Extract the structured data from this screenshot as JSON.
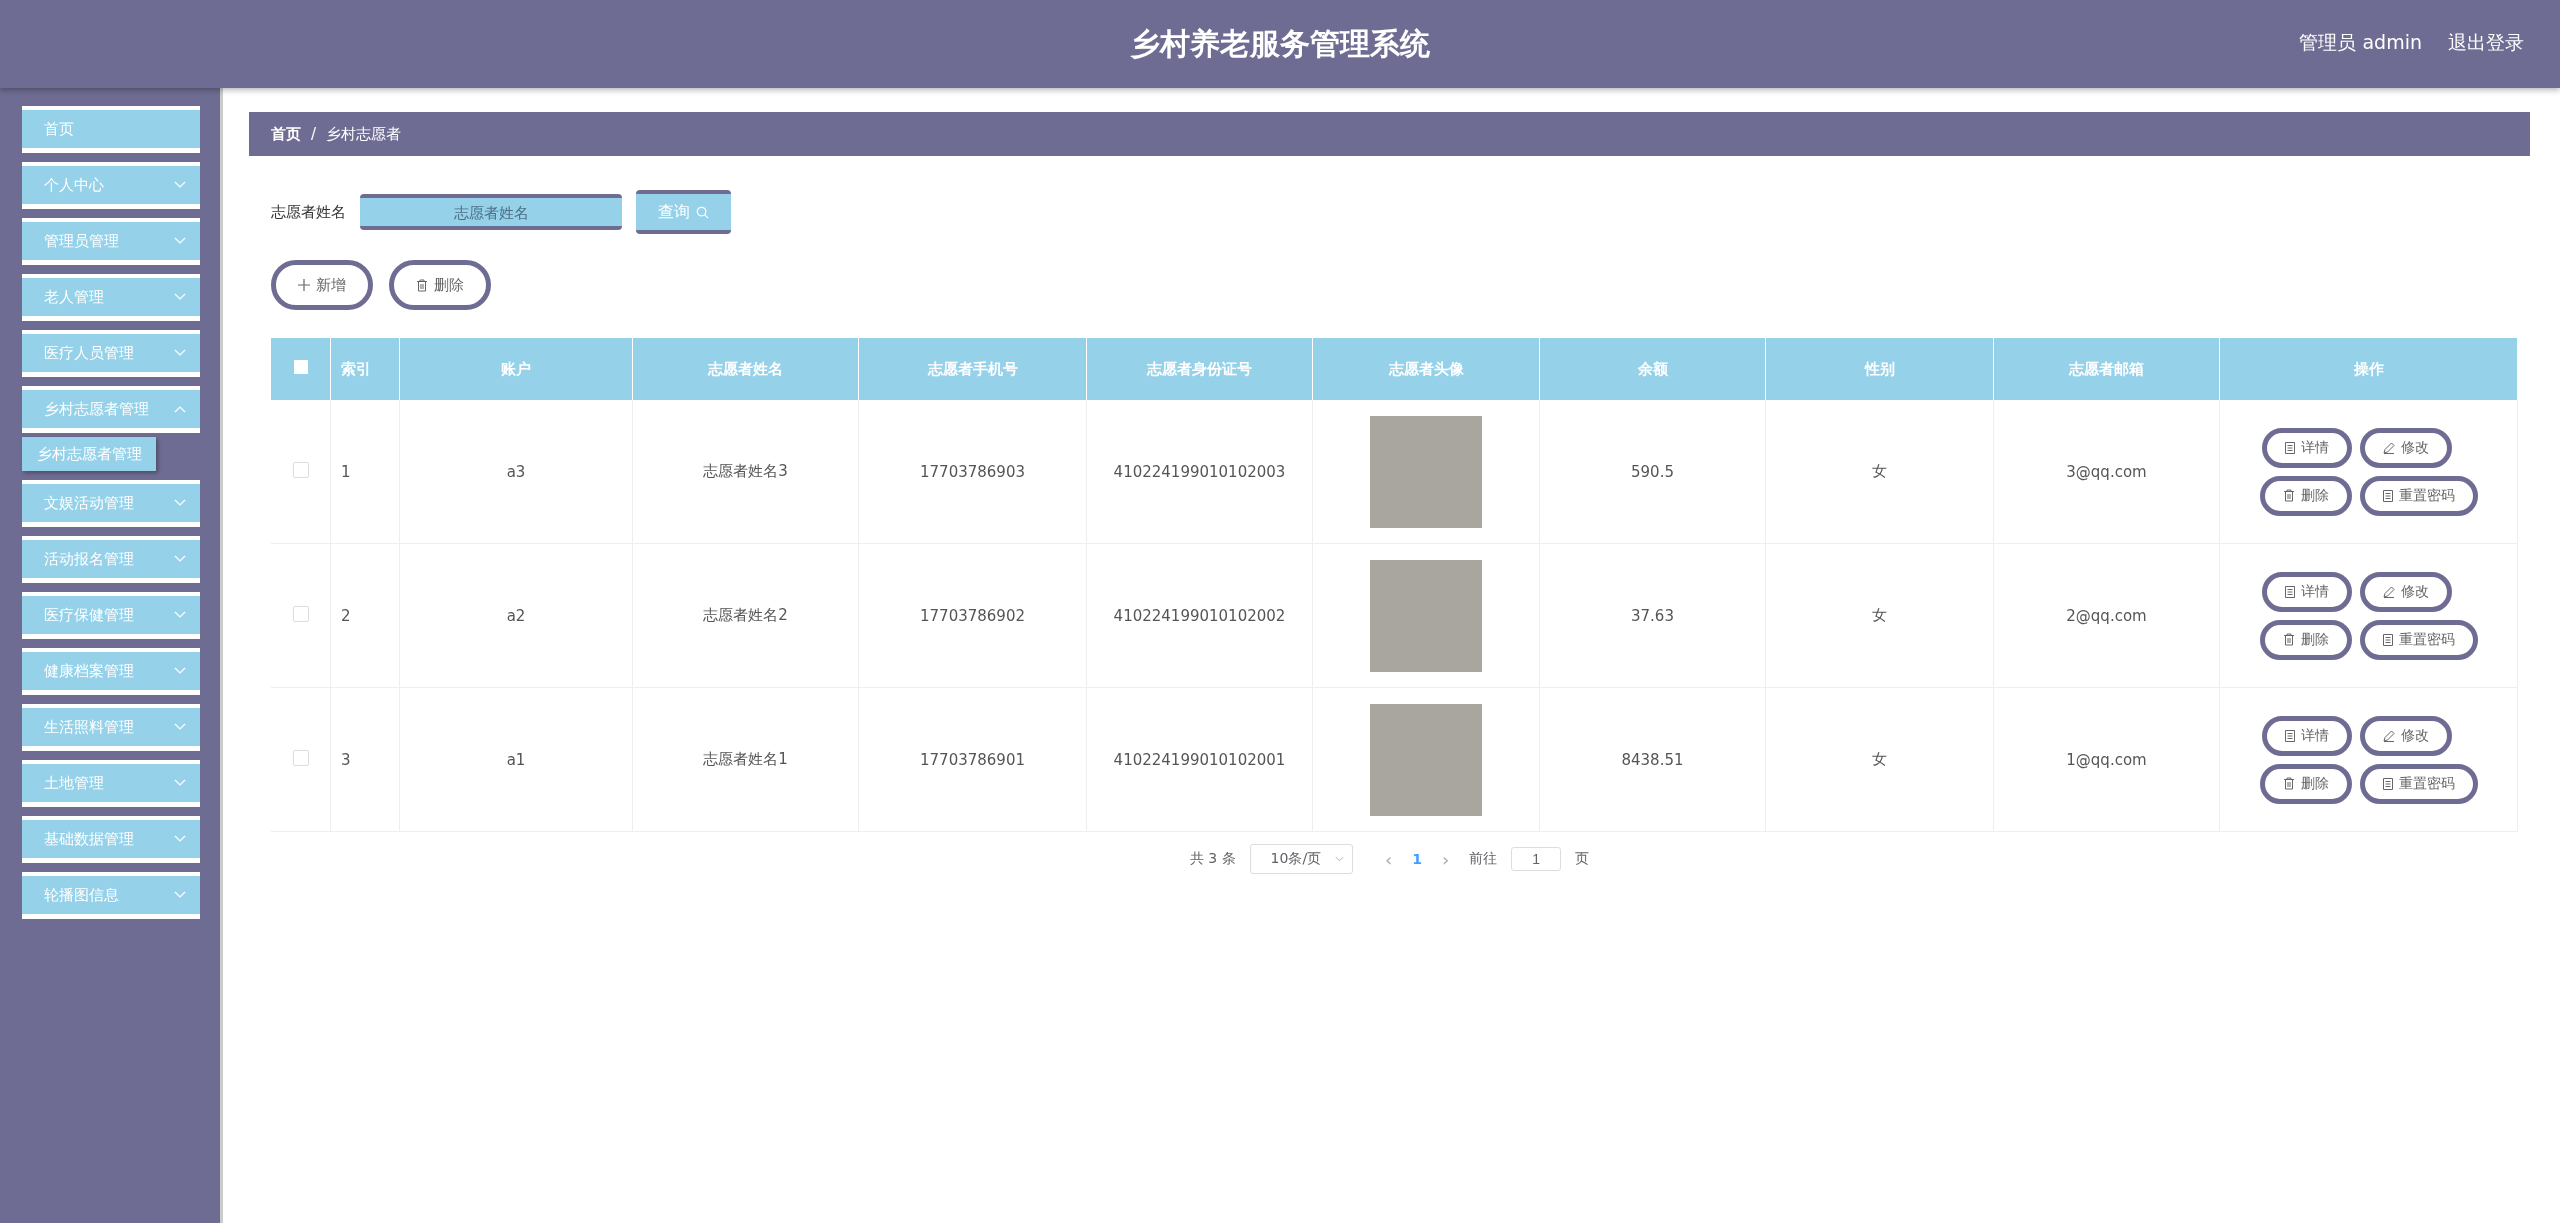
{
  "header": {
    "title": "乡村养老服务管理系统",
    "user": "管理员 admin",
    "logout": "退出登录"
  },
  "sidebar": {
    "items": [
      {
        "label": "首页",
        "kind": "link"
      },
      {
        "label": "个人中心",
        "kind": "submenu",
        "expanded": false
      },
      {
        "label": "管理员管理",
        "kind": "submenu",
        "expanded": false
      },
      {
        "label": "老人管理",
        "kind": "submenu",
        "expanded": false
      },
      {
        "label": "医疗人员管理",
        "kind": "submenu",
        "expanded": false
      },
      {
        "label": "乡村志愿者管理",
        "kind": "submenu",
        "expanded": true,
        "children": [
          {
            "label": "乡村志愿者管理"
          }
        ]
      },
      {
        "label": "文娱活动管理",
        "kind": "submenu",
        "expanded": false
      },
      {
        "label": "活动报名管理",
        "kind": "submenu",
        "expanded": false
      },
      {
        "label": "医疗保健管理",
        "kind": "submenu",
        "expanded": false
      },
      {
        "label": "健康档案管理",
        "kind": "submenu",
        "expanded": false
      },
      {
        "label": "生活照料管理",
        "kind": "submenu",
        "expanded": false
      },
      {
        "label": "土地管理",
        "kind": "submenu",
        "expanded": false
      },
      {
        "label": "基础数据管理",
        "kind": "submenu",
        "expanded": false
      },
      {
        "label": "轮播图信息",
        "kind": "submenu",
        "expanded": false
      }
    ]
  },
  "breadcrumb": [
    "首页",
    "/",
    "乡村志愿者"
  ],
  "search": {
    "label": "志愿者姓名",
    "placeholder": "志愿者姓名",
    "button": "查询"
  },
  "actions": [
    {
      "label": "新增",
      "kind": "add"
    },
    {
      "label": "删除",
      "kind": "delete"
    }
  ],
  "table": {
    "select_all": {
      "checked": false
    },
    "columns": [
      "索引",
      "账户",
      "志愿者姓名",
      "志愿者手机号",
      "志愿者身份证号",
      "志愿者头像",
      "余额",
      "性别",
      "志愿者邮箱",
      "操作"
    ],
    "rows": [
      {
        "checked": false,
        "cells": [
          "1",
          "a3",
          "志愿者姓名3",
          "17703786903",
          "410224199010102003",
          "",
          "590.5",
          "女",
          "3@qq.com"
        ],
        "buttons": [
          {
            "label": "详情",
            "kind": "detail"
          },
          {
            "label": "修改",
            "kind": "edit"
          },
          {
            "label": "删除",
            "kind": "delete"
          },
          {
            "label": "重置密码",
            "kind": "detail"
          }
        ]
      },
      {
        "checked": false,
        "cells": [
          "2",
          "a2",
          "志愿者姓名2",
          "17703786902",
          "410224199010102002",
          "",
          "37.63",
          "女",
          "2@qq.com"
        ],
        "buttons": [
          {
            "label": "详情",
            "kind": "detail"
          },
          {
            "label": "修改",
            "kind": "edit"
          },
          {
            "label": "删除",
            "kind": "delete"
          },
          {
            "label": "重置密码",
            "kind": "detail"
          }
        ]
      },
      {
        "checked": false,
        "cells": [
          "3",
          "a1",
          "志愿者姓名1",
          "17703786901",
          "410224199010102001",
          "",
          "8438.51",
          "女",
          "1@qq.com"
        ],
        "buttons": [
          {
            "label": "详情",
            "kind": "detail"
          },
          {
            "label": "修改",
            "kind": "edit"
          },
          {
            "label": "删除",
            "kind": "delete"
          },
          {
            "label": "重置密码",
            "kind": "detail"
          }
        ]
      }
    ]
  },
  "pagination": {
    "total": "共 3 条",
    "page_size": "10条/页",
    "prev": "‹",
    "pages": [
      {
        "label": "1",
        "selected": true
      }
    ],
    "next": "›",
    "goto": "前往",
    "goto_value": "1",
    "page_unit": "页"
  }
}
